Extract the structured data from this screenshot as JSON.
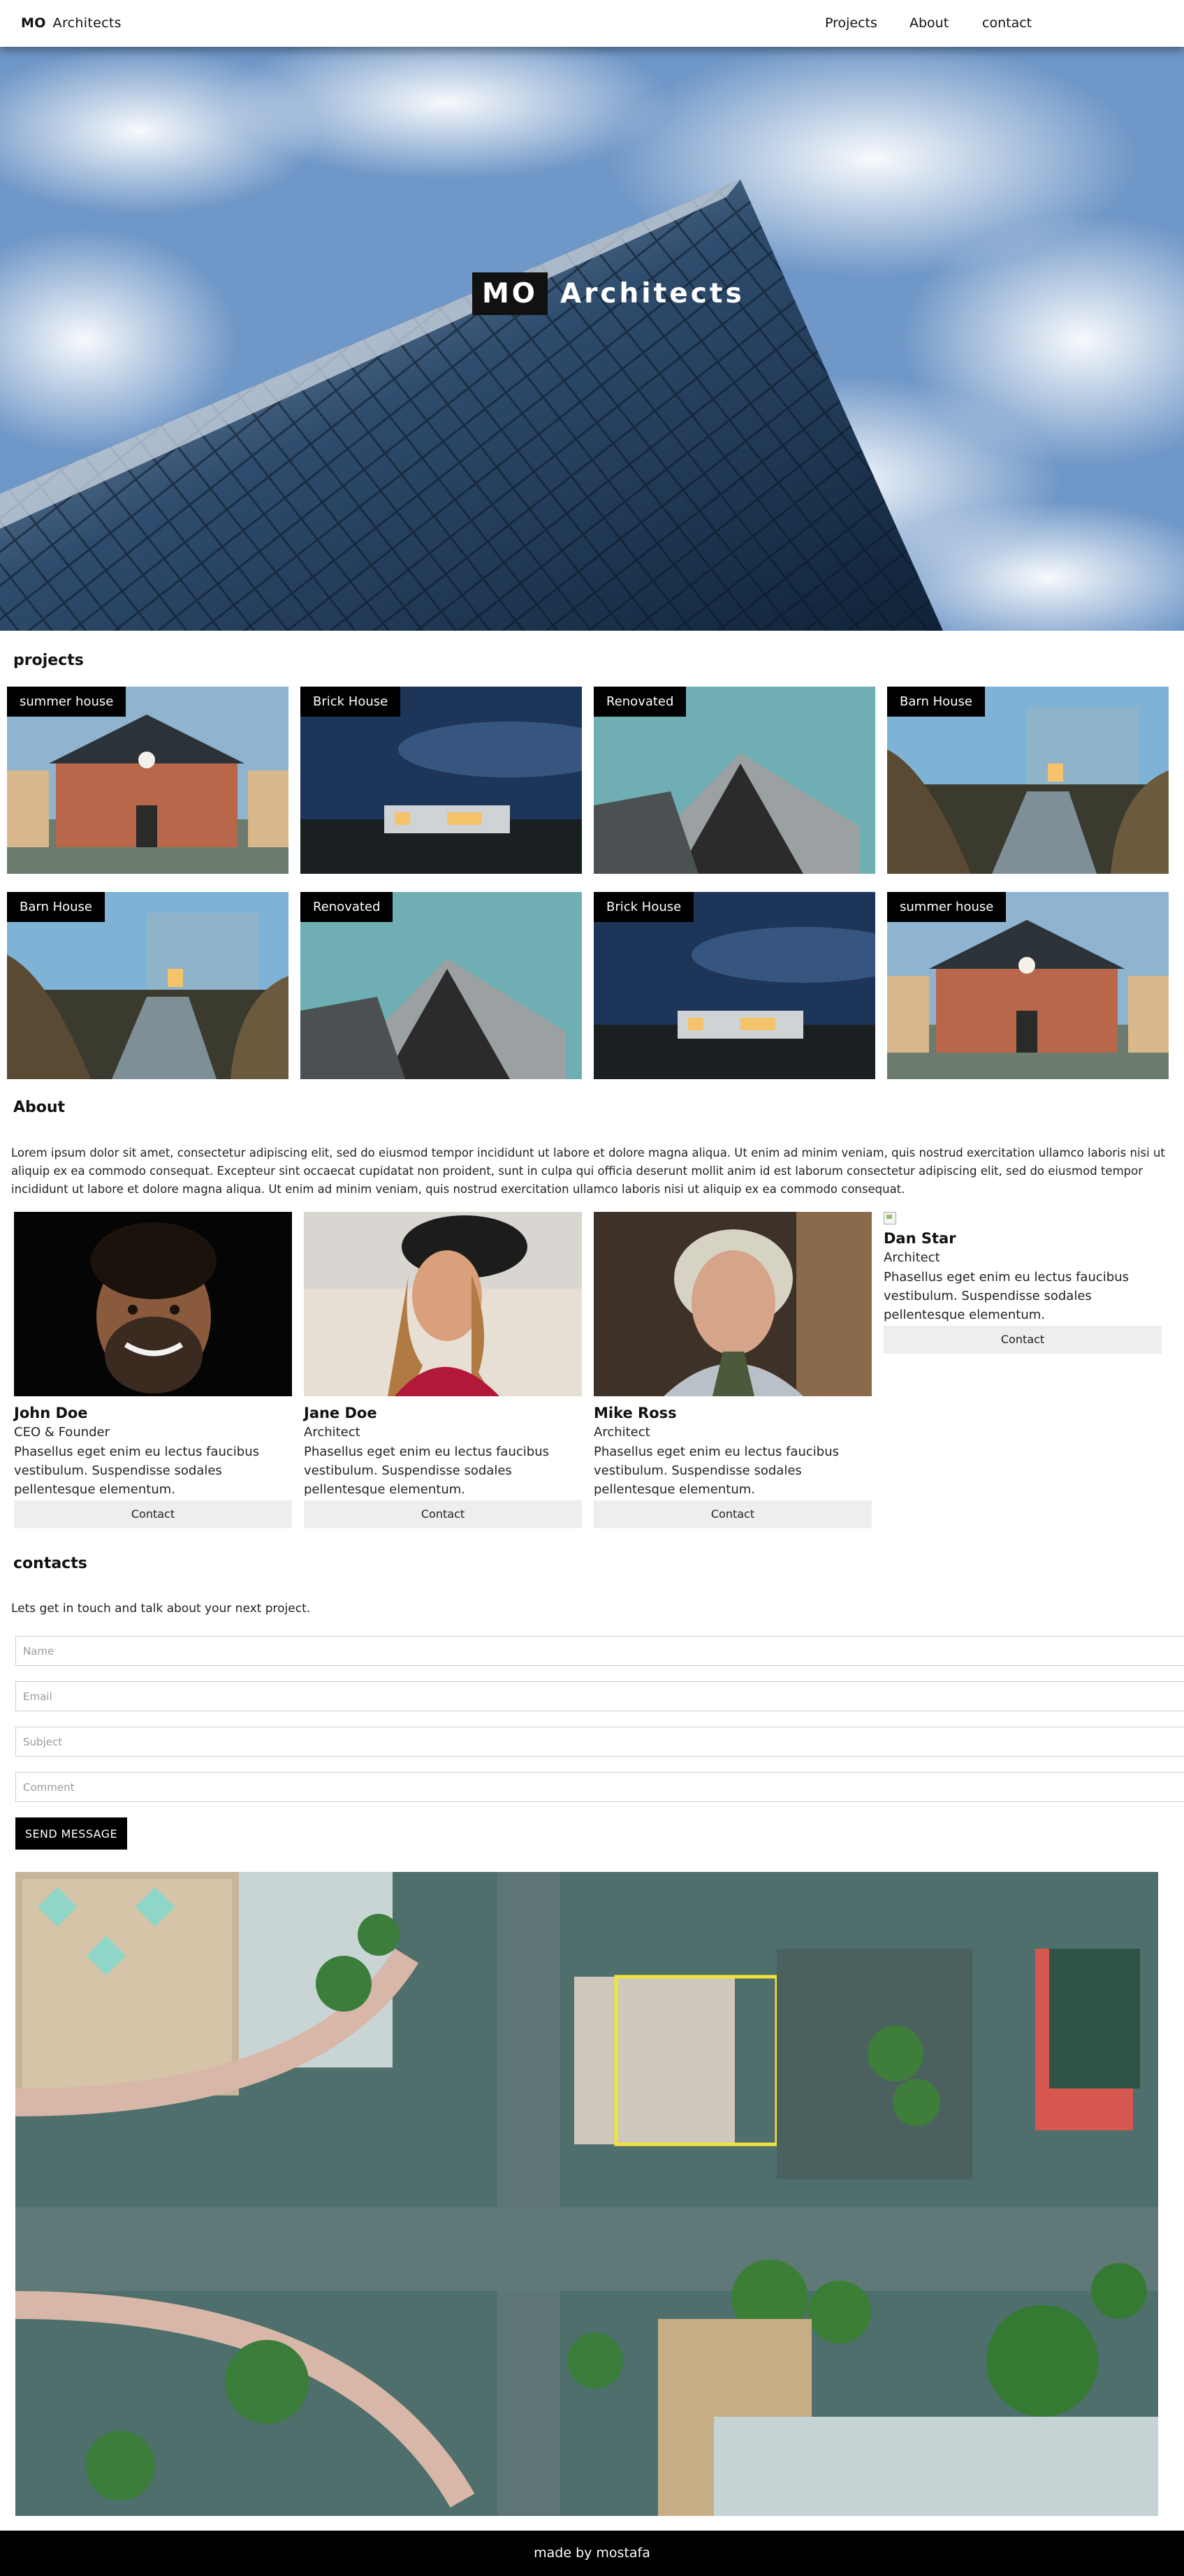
{
  "nav": {
    "brand_mark": "MO",
    "brand_name": "Architects",
    "links": [
      "Projects",
      "About",
      "contact"
    ]
  },
  "hero": {
    "mark": "MO",
    "title": "Architects"
  },
  "projects": {
    "heading": "projects",
    "items": [
      {
        "label": "summer house",
        "image": "brick-house-photo"
      },
      {
        "label": "Brick House",
        "image": "dusk-house-photo"
      },
      {
        "label": "Renovated",
        "image": "gable-roof-photo"
      },
      {
        "label": "Barn House",
        "image": "barn-house-photo"
      },
      {
        "label": "Barn House",
        "image": "barn-house-photo"
      },
      {
        "label": "Renovated",
        "image": "gable-roof-photo"
      },
      {
        "label": "Brick House",
        "image": "dusk-house-photo"
      },
      {
        "label": "summer house",
        "image": "brick-house-photo"
      }
    ]
  },
  "about": {
    "heading": "About",
    "text": "Lorem ipsum dolor sit amet, consectetur adipiscing elit, sed do eiusmod tempor incididunt ut labore et dolore magna aliqua. Ut enim ad minim veniam, quis nostrud exercitation ullamco laboris nisi ut aliquip ex ea commodo consequat. Excepteur sint occaecat cupidatat non proident, sunt in culpa qui officia deserunt mollit anim id est laborum consectetur adipiscing elit, sed do eiusmod tempor incididunt ut labore et dolore magna aliqua. Ut enim ad minim veniam, quis nostrud exercitation ullamco laboris nisi ut aliquip ex ea commodo consequat.",
    "team": [
      {
        "name": "John Doe",
        "role": "CEO & Founder",
        "bio": "Phasellus eget enim eu lectus faucibus vestibulum. Suspendisse sodales pellentesque elementum.",
        "button": "Contact"
      },
      {
        "name": "Jane Doe",
        "role": "Architect",
        "bio": "Phasellus eget enim eu lectus faucibus vestibulum. Suspendisse sodales pellentesque elementum.",
        "button": "Contact"
      },
      {
        "name": "Mike Ross",
        "role": "Architect",
        "bio": "Phasellus eget enim eu lectus faucibus vestibulum. Suspendisse sodales pellentesque elementum.",
        "button": "Contact"
      },
      {
        "name": "Dan Star",
        "role": "Architect",
        "bio": "Phasellus eget enim eu lectus faucibus vestibulum. Suspendisse sodales pellentesque elementum.",
        "button": "Contact"
      }
    ]
  },
  "contact": {
    "heading": "contacts",
    "lead": "Lets get in touch and talk about your next project.",
    "placeholders": {
      "name": "Name",
      "email": "Email",
      "subject": "Subject",
      "comment": "Comment"
    },
    "submit": "SEND MESSAGE"
  },
  "footer": {
    "text": "made by mostafa"
  },
  "colors": {
    "accent": "#000000",
    "button_bg": "#eeeeee",
    "map_highlight": "#f2e33a"
  }
}
